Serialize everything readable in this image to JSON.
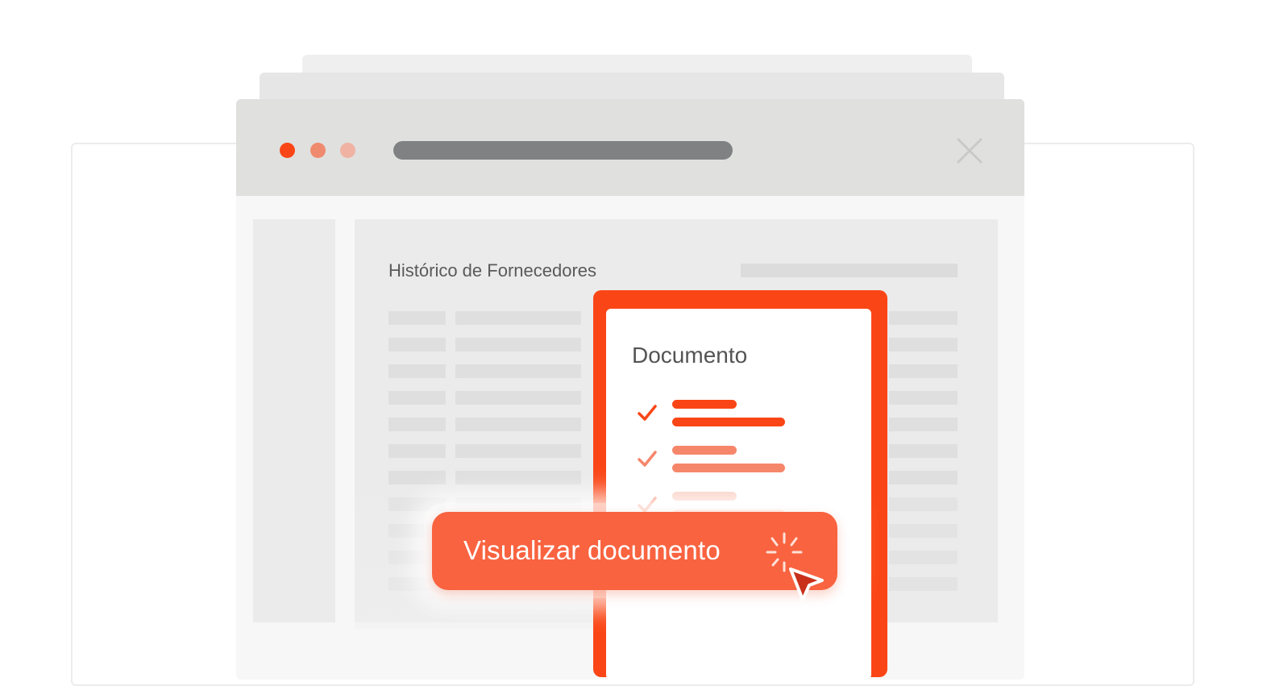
{
  "window": {
    "dots": [
      "window-dot-close",
      "window-dot-minimize",
      "window-dot-maximize"
    ],
    "icons": {
      "close": "close-icon"
    }
  },
  "main": {
    "title": "Histórico de Fornecedores"
  },
  "document_card": {
    "title": "Documento",
    "icons": {
      "check": "check-icon"
    }
  },
  "cta": {
    "label": "Visualizar documento",
    "icons": {
      "click": "click-burst-icon",
      "cursor": "cursor-pointer-icon"
    }
  },
  "colors": {
    "accent": "#fa4616",
    "button": "#f96340",
    "line_strong": "#fa4616",
    "line_mid": "#f6866a",
    "line_light": "#f9c7b9"
  }
}
